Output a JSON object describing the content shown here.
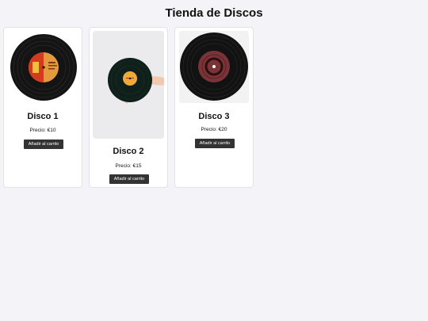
{
  "page": {
    "title": "Tienda de Discos"
  },
  "products": [
    {
      "name": "Disco 1",
      "price": "Precio: €10",
      "button_label": "Añadir al carrito",
      "image": "vinyl-record-red-label"
    },
    {
      "name": "Disco 2",
      "price": "Precio: €15",
      "button_label": "Añadir al carrito",
      "image": "hand-holding-vinyl-record"
    },
    {
      "name": "Disco 3",
      "price": "Precio: €20",
      "button_label": "Añadir al carrito",
      "image": "vinyl-record-maroon-label"
    }
  ],
  "colors": {
    "background": "#f4f4f8",
    "card": "#ffffff",
    "button": "#333333",
    "button_text": "#ffffff"
  }
}
